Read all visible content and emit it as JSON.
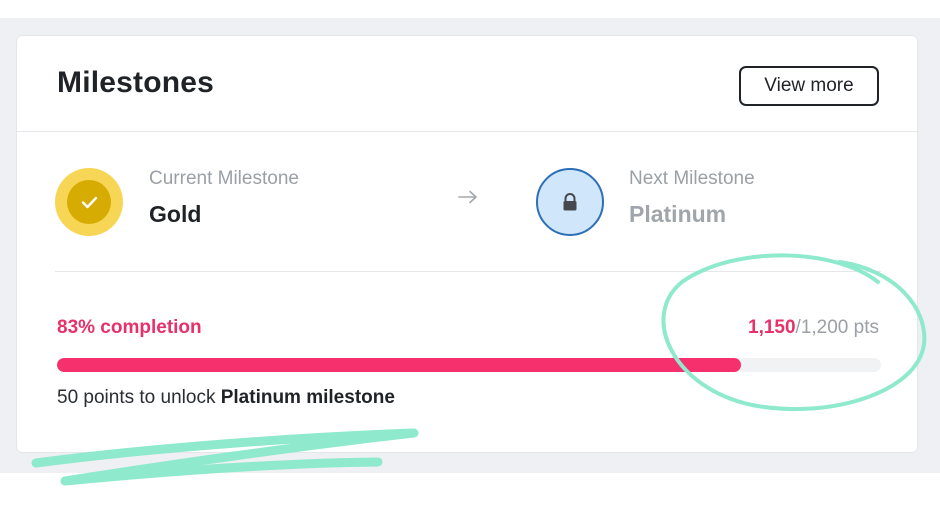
{
  "card": {
    "title": "Milestones",
    "view_more_label": "View more"
  },
  "current_milestone": {
    "label": "Current Milestone",
    "value": "Gold",
    "icon": "checkmark-icon",
    "color": "#d6ac02"
  },
  "next_milestone": {
    "label": "Next Milestone",
    "value": "Platinum",
    "icon": "lock-icon",
    "color": "#cfe6fb"
  },
  "progress": {
    "completion_text": "83% completion",
    "percent": 83,
    "points_earned": "1,150",
    "points_total": "1,200 pts",
    "unlock_prefix": "50 points to unlock ",
    "unlock_target": "Platinum milestone",
    "accent_color": "#f5306c"
  }
}
